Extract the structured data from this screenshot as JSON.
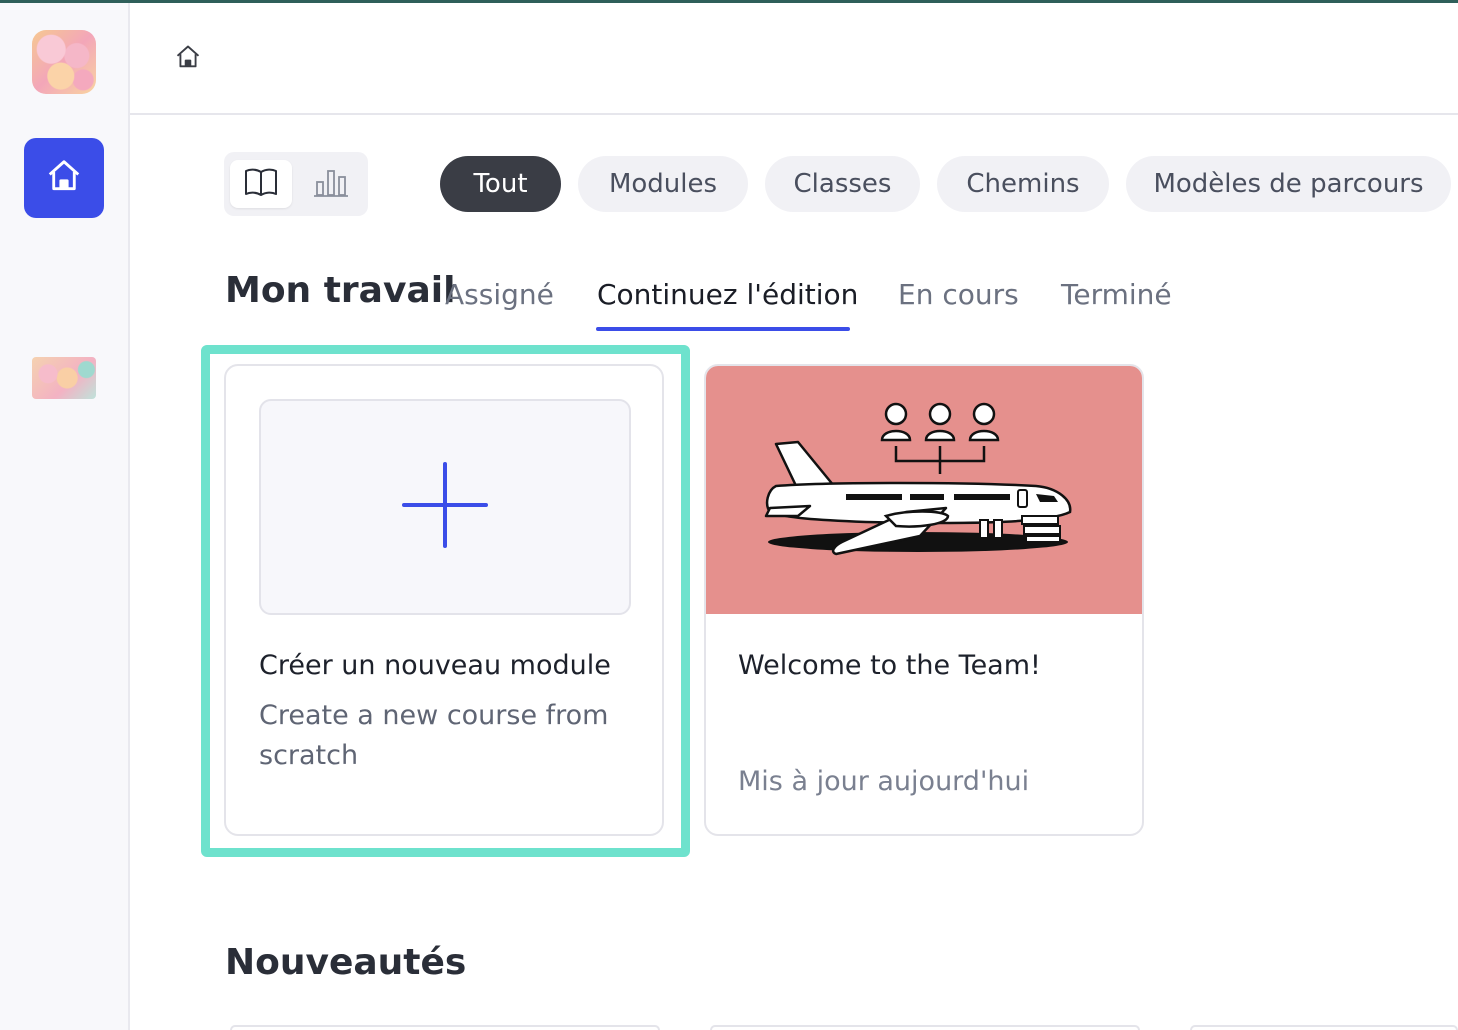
{
  "sidebar": {
    "avatar_top": "workspace-avatar",
    "home_icon": "home-icon",
    "avatar_small": "profile-avatar"
  },
  "topbar": {
    "home_icon": "home-outline-icon"
  },
  "view_toggle": {
    "options": [
      {
        "icon": "book-open-icon",
        "active": true
      },
      {
        "icon": "bar-chart-icon",
        "active": false
      }
    ]
  },
  "filters": [
    {
      "label": "Tout",
      "active": true
    },
    {
      "label": "Modules",
      "active": false
    },
    {
      "label": "Classes",
      "active": false
    },
    {
      "label": "Chemins",
      "active": false
    },
    {
      "label": "Modèles de parcours",
      "active": false
    }
  ],
  "my_work": {
    "title": "Mon travail",
    "tabs": [
      {
        "label": "Assigné",
        "active": false
      },
      {
        "label": "Continuez l'édition",
        "active": true
      },
      {
        "label": "En cours",
        "active": false
      },
      {
        "label": "Terminé",
        "active": false
      }
    ]
  },
  "cards": {
    "create": {
      "icon": "plus-icon",
      "title": "Créer un nouveau module",
      "description": "Create a new course from scratch"
    },
    "course": {
      "image": "airplane-team-illustration",
      "title": "Welcome to the Team!",
      "updated": "Mis à jour aujourd'hui"
    }
  },
  "whats_new": {
    "title": "Nouveautés"
  },
  "colors": {
    "accent": "#3b4de8",
    "highlight": "#6ee2cd",
    "pill_active": "#3a3d45",
    "course_image_bg": "#e5908d"
  }
}
